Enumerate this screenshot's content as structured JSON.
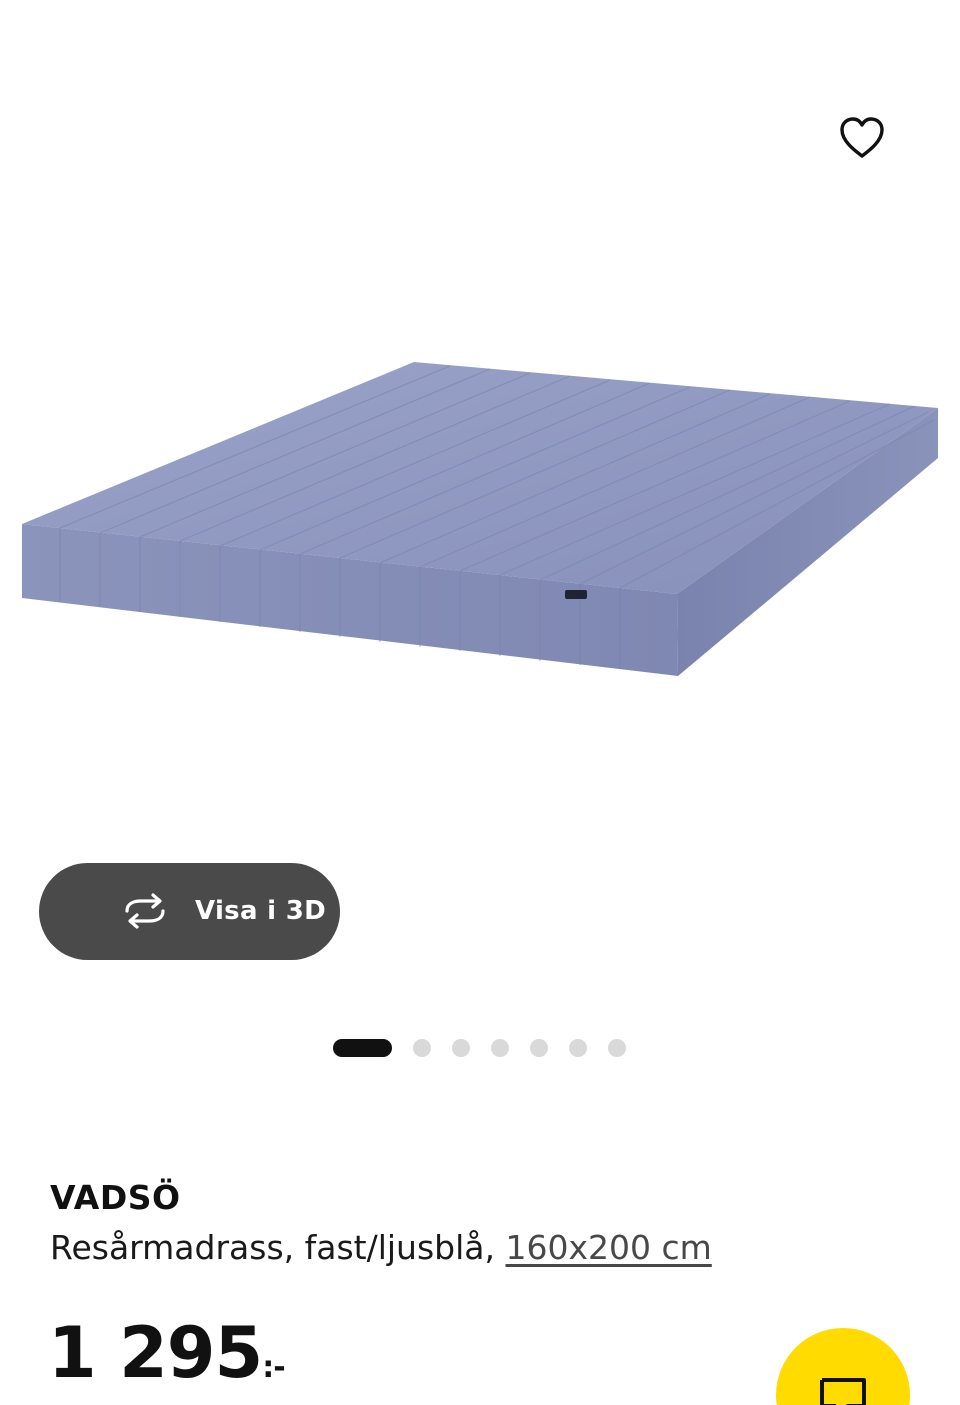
{
  "product": {
    "name": "VADSÖ",
    "description": "Resårmadrass, fast/ljusblå,",
    "size_link": "160x200 cm",
    "price": "1 295",
    "price_suffix": ":-"
  },
  "gallery": {
    "view_3d_label": "Visa i 3D",
    "image_count": 7,
    "active_index": 0
  },
  "icons": {
    "favorite": "heart-icon",
    "view_3d": "rotate-3d-icon",
    "cart": "add-to-cart-icon"
  },
  "colors": {
    "mattress": "#8d97bf",
    "view_3d_button": "#4a4a4a",
    "cart_button": "#ffdb00",
    "active_dot": "#111111",
    "inactive_dot": "#d9d9d9"
  }
}
